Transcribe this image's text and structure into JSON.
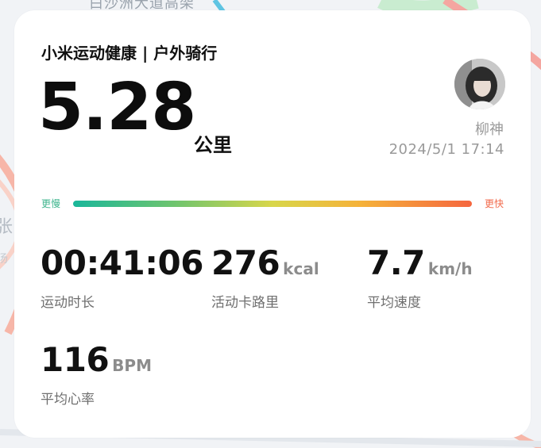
{
  "map": {
    "label_top": "白沙洲大道高架",
    "label_side": "张",
    "label_side2": "汤"
  },
  "header": {
    "title": "小米运动健康 | 户外骑行"
  },
  "distance": {
    "value": "5.28",
    "unit": "公里"
  },
  "user": {
    "avatar_icon": "user-avatar",
    "name": "柳神",
    "datetime": "2024/5/1  17:14"
  },
  "speed_scale": {
    "slow_label": "更慢",
    "fast_label": "更快",
    "colors": [
      "#1ab79a",
      "#6dc46f",
      "#d8d64a",
      "#f5b23a",
      "#f5663f"
    ]
  },
  "stats": {
    "duration": {
      "value": "00:41:06",
      "unit": "",
      "label": "运动时长"
    },
    "calories": {
      "value": "276",
      "unit": "kcal",
      "label": "活动卡路里"
    },
    "speed": {
      "value": "7.7",
      "unit": "km/h",
      "label": "平均速度"
    },
    "heart_rate": {
      "value": "116",
      "unit": "BPM",
      "label": "平均心率"
    }
  }
}
